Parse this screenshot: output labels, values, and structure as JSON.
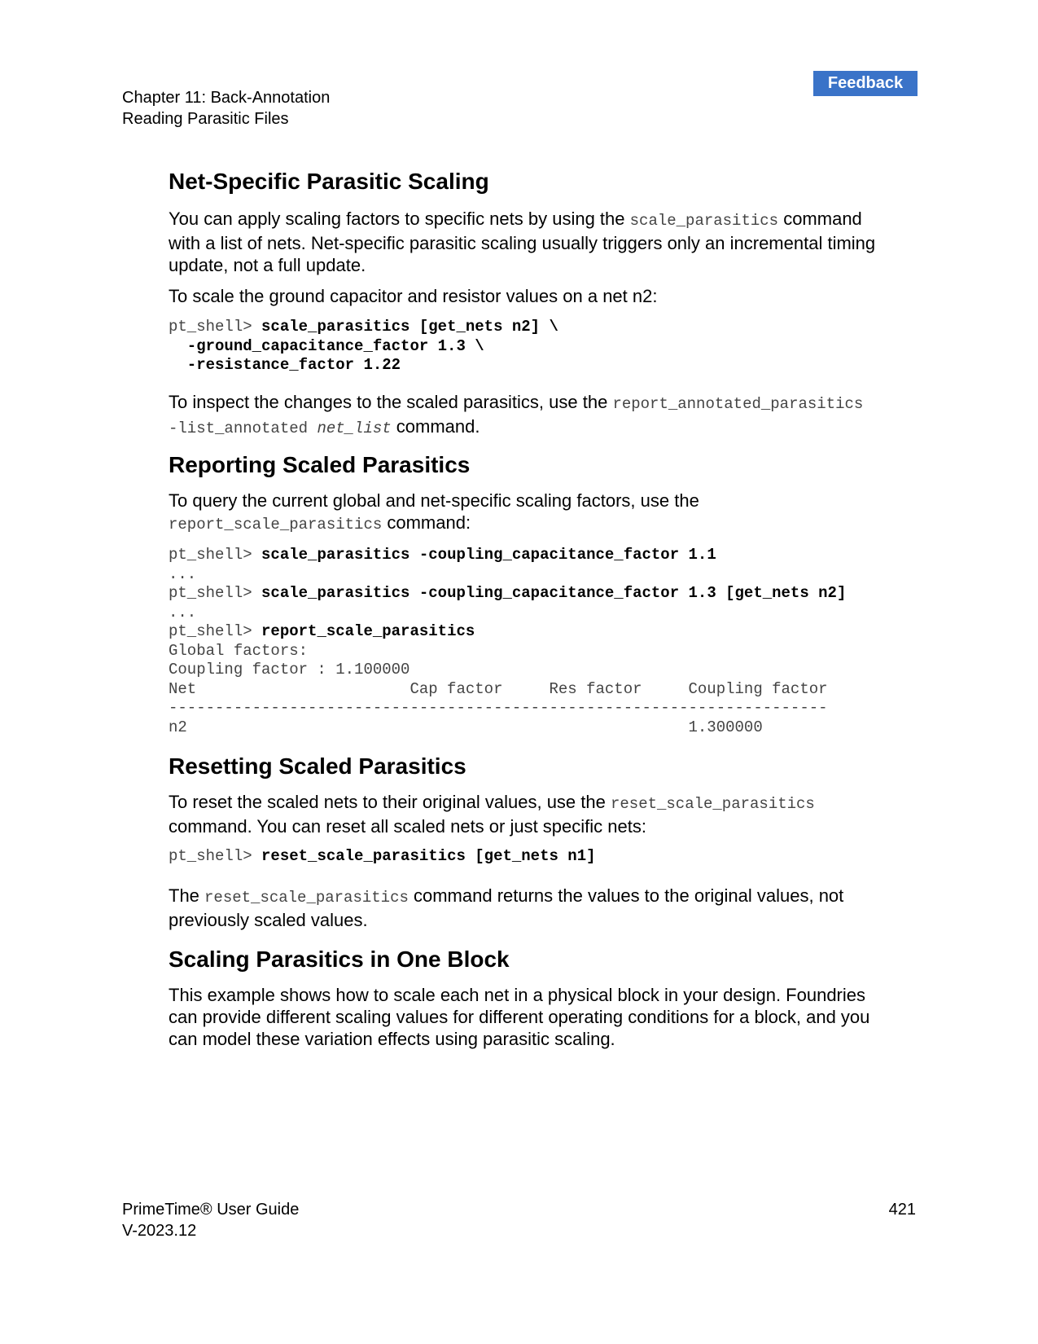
{
  "feedback_label": "Feedback",
  "header": {
    "chapter": "Chapter 11: Back-Annotation",
    "section": "Reading Parasitic Files"
  },
  "sec1": {
    "title": "Net-Specific Parasitic Scaling",
    "p1_a": "You can apply scaling factors to specific nets by using the ",
    "p1_code": "scale_parasitics",
    "p1_b": " command",
    "p1_line2": "with a list of nets. Net-specific parasitic scaling usually triggers only an incremental timing",
    "p1_line3": "update, not a full update.",
    "p2": "To scale the ground capacitor and resistor values on a net n2:",
    "code_prompt": "pt_shell> ",
    "code_l1": "scale_parasitics [get_nets n2] \\",
    "code_l2": "  -ground_capacitance_factor 1.3 \\",
    "code_l3": "  -resistance_factor 1.22",
    "p3_a": "To inspect the changes to the scaled parasitics, use the ",
    "p3_code1": "report_annotated_parasitics",
    "p3_code2": "-list_annotated ",
    "p3_code3": "net_list",
    "p3_b": " command."
  },
  "sec2": {
    "title": "Reporting Scaled Parasitics",
    "p1_line1": "To query the current global and net-specific scaling factors, use the",
    "p1_code": "report_scale_parasitics",
    "p1_b": " command:",
    "prompt": "pt_shell> ",
    "cmd1": "scale_parasitics -coupling_capacitance_factor 1.1",
    "dots": "...",
    "cmd2": "scale_parasitics -coupling_capacitance_factor 1.3 [get_nets n2]",
    "cmd3": "report_scale_parasitics",
    "out1": "Global factors:",
    "out2": "Coupling factor : 1.100000",
    "out3": "Net                       Cap factor     Res factor     Coupling factor",
    "out4": "-----------------------------------------------------------------------",
    "out5": "n2                                                      1.300000"
  },
  "sec3": {
    "title": "Resetting Scaled Parasitics",
    "p1_a": "To reset the scaled nets to their original values, use the ",
    "p1_code": "reset_scale_parasitics",
    "p1_line2": "command. You can reset all scaled nets or just specific nets:",
    "prompt": "pt_shell> ",
    "cmd": "reset_scale_parasitics [get_nets n1]",
    "p2_a": "The ",
    "p2_code": "reset_scale_parasitics",
    "p2_b": " command returns the values to the original values, not",
    "p2_line2": "previously scaled values."
  },
  "sec4": {
    "title": "Scaling Parasitics in One Block",
    "l1": "This example shows how to scale each net in a physical block in your design. Foundries",
    "l2": "can provide different scaling values for different operating conditions for a block, and you",
    "l3": "can model these variation effects using parasitic scaling."
  },
  "footer": {
    "guide": "PrimeTime® User Guide",
    "version": "V-2023.12",
    "page": "421"
  }
}
